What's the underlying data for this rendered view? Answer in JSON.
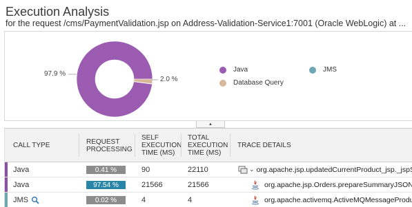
{
  "header": {
    "title": "Execution Analysis",
    "subtitle": "for the request /cms/PaymentValidation.jsp on Address-Validation-Service1:7001 (Oracle WebLogic) at ..."
  },
  "chart_data": {
    "type": "pie",
    "slices": [
      {
        "name": "Java",
        "value": 97.9,
        "label": "97.9 %",
        "color": "#9a5bb0"
      },
      {
        "name": "Database Query",
        "value": 2.0,
        "label": "2.0 %",
        "color": "#d7b89a"
      },
      {
        "name": "JMS",
        "value": 0.1,
        "label": "",
        "color": "#6fa6b6"
      }
    ],
    "legend": [
      {
        "name": "Java",
        "color": "#9a5bb0"
      },
      {
        "name": "JMS",
        "color": "#6fa6b6"
      },
      {
        "name": "Database Query",
        "color": "#d7b89a"
      }
    ],
    "legend_placement": "right"
  },
  "toolbar": {
    "collapse_icon": "chevron-up-icon",
    "collapse_glyph": "▲"
  },
  "table": {
    "columns": [
      "CALL TYPE",
      "REQUEST PROCESSING",
      "SELF EXECUTION TIME (ms)",
      "TOTAL EXECUTION TIME (ms)",
      "TRACE DETAILS"
    ],
    "rows": [
      {
        "call_type": "Java",
        "marker_color": "#8b4fa3",
        "request_processing": "0.41 %",
        "badge_color": "#8c8c8c",
        "self_time": "90",
        "total_time": "22110",
        "expand_glyph": "⌄",
        "trace": "org.apache.jsp.updatedCurrentProduct_jsp._jspService()",
        "has_search": false,
        "has_expand": true
      },
      {
        "call_type": "Java",
        "marker_color": "#8b4fa3",
        "request_processing": "97.54 %",
        "badge_color": "#2a86a8",
        "self_time": "21566",
        "total_time": "21566",
        "expand_glyph": "",
        "trace": "org.apache.jsp.Orders.prepareSummaryJSON()",
        "has_search": false,
        "has_expand": false
      },
      {
        "call_type": "JMS",
        "marker_color": "#6fa6b6",
        "request_processing": "0.02 %",
        "badge_color": "#8c8c8c",
        "self_time": "4",
        "total_time": "4",
        "expand_glyph": "",
        "trace": "org.apache.activemq.ActiveMQMessageProducer.send()",
        "has_search": true,
        "has_expand": false
      }
    ]
  }
}
